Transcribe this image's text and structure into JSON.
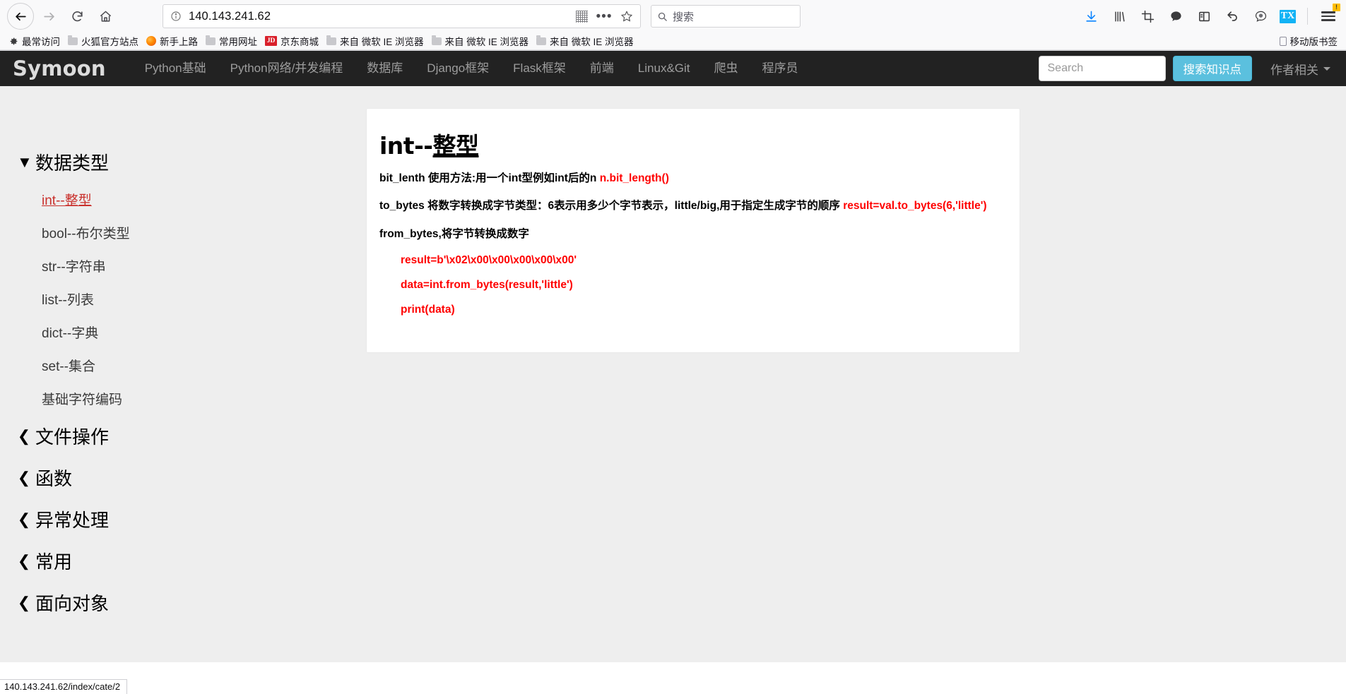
{
  "browser": {
    "back_icon": "arrow-left-icon",
    "forward_icon": "arrow-right-icon",
    "reload_icon": "reload-icon",
    "home_icon": "home-icon",
    "url": "140.143.241.62",
    "url_info_icon": "info-circle-icon",
    "qr_icon": "qr-code-icon",
    "more_icon": "ellipsis-icon",
    "bookmark_star_icon": "star-icon",
    "search_placeholder": "搜索",
    "search_value": "",
    "toolbar_icons": [
      {
        "name": "download-icon",
        "glyph": "↓"
      },
      {
        "name": "library-icon",
        "glyph": "|||\\"
      },
      {
        "name": "screenshot-icon",
        "glyph": "⌗"
      },
      {
        "name": "chat-bubble-icon",
        "glyph": "💬"
      },
      {
        "name": "sidebar-icon",
        "glyph": "▤"
      },
      {
        "name": "undo-icon",
        "glyph": "↶"
      },
      {
        "name": "translate-icon",
        "glyph": "◉"
      },
      {
        "name": "tx-extension-icon",
        "glyph": "TX"
      }
    ],
    "menu_badge": "!",
    "bookmarks": [
      {
        "label": "最常访问",
        "icon": "gear-icon"
      },
      {
        "label": "火狐官方站点",
        "icon": "folder-icon"
      },
      {
        "label": "新手上路",
        "icon": "firefox-icon"
      },
      {
        "label": "常用网址",
        "icon": "folder-icon"
      },
      {
        "label": "京东商城",
        "icon": "jd-icon"
      },
      {
        "label": "来自 微软 IE 浏览器",
        "icon": "folder-icon"
      },
      {
        "label": "来自 微软 IE 浏览器",
        "icon": "folder-icon"
      },
      {
        "label": "来自 微软 IE 浏览器",
        "icon": "folder-icon"
      }
    ],
    "mobile_bookmarks": "移动版书签",
    "statusbar_url": "140.143.241.62/index/cate/2"
  },
  "site": {
    "brand": "Symoon",
    "nav_links": [
      "Python基础",
      "Python网络/并发编程",
      "数据库",
      "Django框架",
      "Flask框架",
      "前端",
      "Linux&Git",
      "爬虫",
      "程序员"
    ],
    "search_placeholder": "Search",
    "search_value": "",
    "search_button": "搜索知识点",
    "author_menu": "作者相关",
    "accent_color": "#5bc0de",
    "navbar_color": "#222222"
  },
  "sidebar": {
    "groups": [
      {
        "title": "数据类型",
        "expanded": true,
        "chevron": "▼",
        "items": [
          {
            "label": "int--整型",
            "active": true
          },
          {
            "label": "bool--布尔类型",
            "active": false
          },
          {
            "label": "str--字符串",
            "active": false
          },
          {
            "label": "list--列表",
            "active": false
          },
          {
            "label": "dict--字典",
            "active": false
          },
          {
            "label": "set--集合",
            "active": false
          },
          {
            "label": "基础字符编码",
            "active": false
          }
        ]
      },
      {
        "title": "文件操作",
        "expanded": false,
        "chevron": "❮",
        "items": []
      },
      {
        "title": "函数",
        "expanded": false,
        "chevron": "❮",
        "items": []
      },
      {
        "title": "异常处理",
        "expanded": false,
        "chevron": "❮",
        "items": []
      },
      {
        "title": "常用",
        "expanded": false,
        "chevron": "❮",
        "items": []
      },
      {
        "title": "面向对象",
        "expanded": false,
        "chevron": "❮",
        "items": []
      }
    ]
  },
  "article": {
    "title_plain": "int--",
    "title_underlined": "整型",
    "line1_text": "bit_lenth 使用方法:用一个int型例如int后的n",
    "line1_code": "n.bit_length()",
    "line2_text": "to_bytes 将数字转换成字节类型：6表示用多少个字节表示，little/big,用于指定生成字节的顺序",
    "line2_code": "result=val.to_bytes(6,'little')",
    "line3_text": "from_bytes,将字节转换成数字",
    "code_lines": [
      "result=b'\\x02\\x00\\x00\\x00\\x00\\x00'",
      "data=int.from_bytes(result,'little')",
      "print(data)"
    ],
    "code_color": "#ff0000"
  }
}
